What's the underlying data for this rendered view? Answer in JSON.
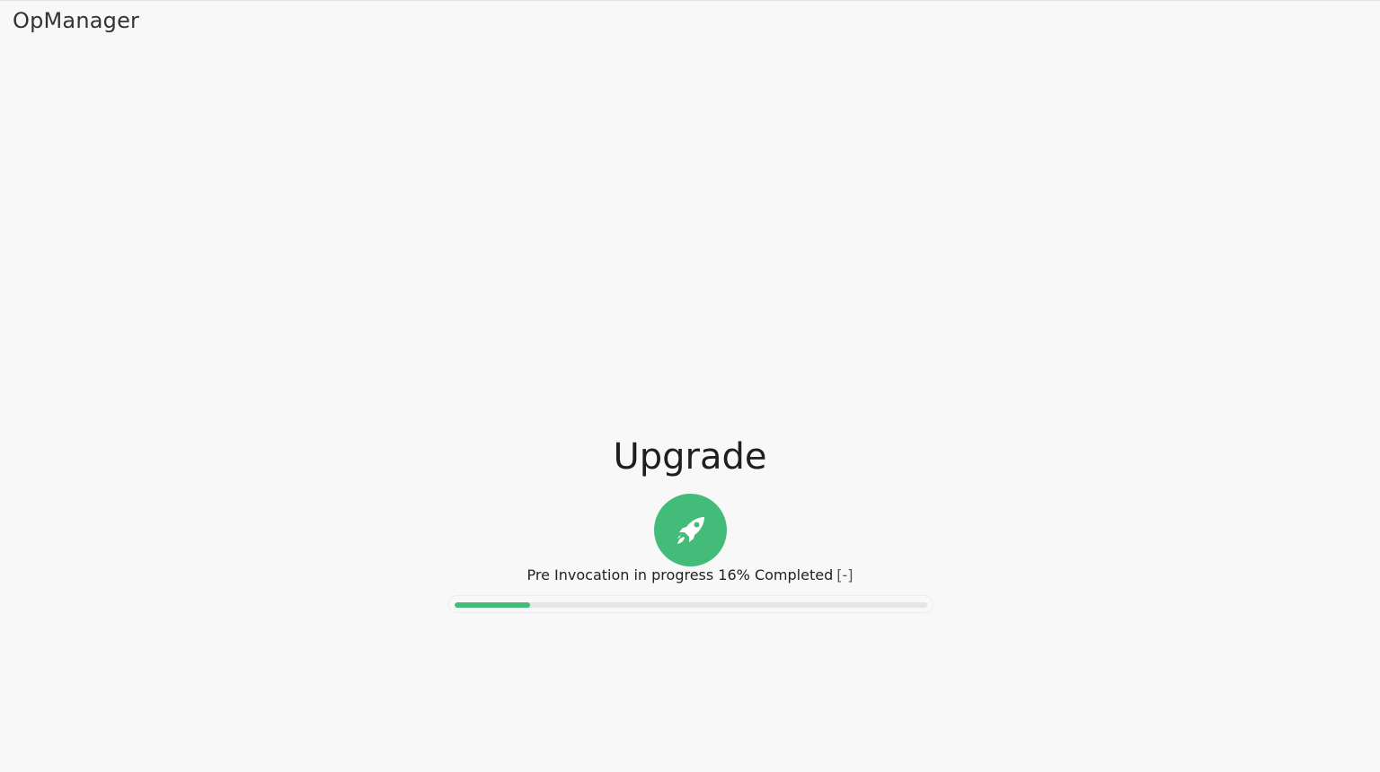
{
  "app": {
    "brand": "OpManager"
  },
  "upgrade": {
    "title": "Upgrade",
    "icon": "rocket-icon",
    "status_text": "Pre Invocation in progress 16% Completed",
    "details_toggle": "[-]",
    "progress_percent": 16
  },
  "colors": {
    "accent": "#43bc7a",
    "track": "#e5e5e5",
    "background": "#f8f8f8"
  }
}
